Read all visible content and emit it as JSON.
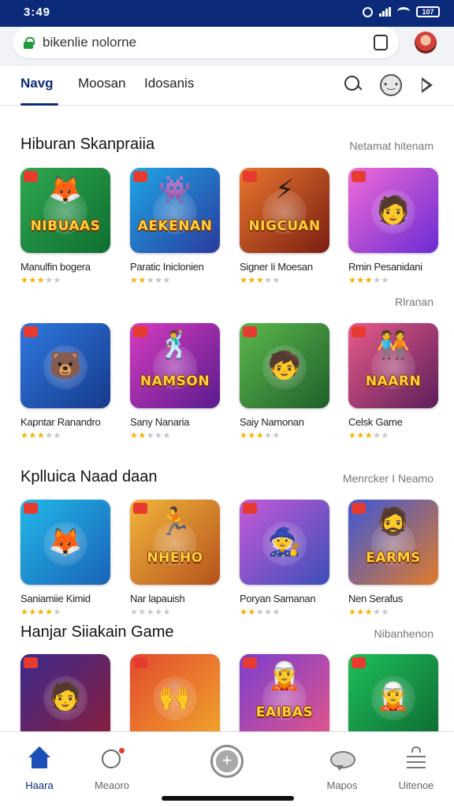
{
  "status": {
    "time": "3:49",
    "battery": "107"
  },
  "url": {
    "text": "bikenlie nolorne"
  },
  "nav": {
    "tabs": [
      "Navg",
      "Moosan",
      "Idosanis"
    ]
  },
  "sections": [
    {
      "title": "Hiburan Skanpraiia",
      "more": "Netamat hitenam",
      "games": [
        {
          "name": "Manulfin bogera",
          "stars": 3,
          "banner": "NIBUAAS",
          "colors": [
            "#2fa84f",
            "#0f6e31"
          ],
          "glyph": "🦊"
        },
        {
          "name": "Paratic Iniclonien",
          "stars": 2,
          "banner": "AEKENAN",
          "colors": [
            "#1ea7e6",
            "#2a3a9e"
          ],
          "glyph": "👾"
        },
        {
          "name": "Signer Ii Moesan",
          "stars": 3,
          "banner": "NIGCUAN",
          "colors": [
            "#e8762d",
            "#7a1e12"
          ],
          "glyph": "⚡"
        },
        {
          "name": "Rmin Pesanidani",
          "stars": 3,
          "banner": "",
          "colors": [
            "#f06bd6",
            "#6a2bd3"
          ],
          "glyph": "🧑"
        }
      ]
    },
    {
      "title": "",
      "more": "Rlranan",
      "games": [
        {
          "name": "Kapntar Ranandro",
          "stars": 3,
          "banner": "",
          "colors": [
            "#2f79e0",
            "#173a8c"
          ],
          "glyph": "🐻"
        },
        {
          "name": "Sany Nanaria",
          "stars": 2,
          "banner": "NAMSON",
          "colors": [
            "#d63cc0",
            "#5a1c8e"
          ],
          "glyph": "🕺"
        },
        {
          "name": "Saiy Namonan",
          "stars": 3,
          "banner": "",
          "colors": [
            "#5cb84d",
            "#1f5e2a"
          ],
          "glyph": "🧒"
        },
        {
          "name": "Celsk Game",
          "stars": 3,
          "banner": "NAARN",
          "colors": [
            "#e85b8a",
            "#5b1e5a"
          ],
          "glyph": "🧑‍🤝‍🧑"
        }
      ]
    },
    {
      "title": "Kplluica Naad daan",
      "more": "Menrcker I Neamo",
      "games": [
        {
          "name": "Saniamiie Kimid",
          "stars": 4,
          "banner": "",
          "colors": [
            "#22b8e8",
            "#1a63b8"
          ],
          "glyph": "🦊"
        },
        {
          "name": "Nar lapauish",
          "stars": 0,
          "banner": "NHEHO",
          "colors": [
            "#f2b53c",
            "#b5521c"
          ],
          "glyph": "🏃"
        },
        {
          "name": "Poryan Samanan",
          "stars": 2,
          "banner": "",
          "colors": [
            "#c75ad8",
            "#3c4fb9"
          ],
          "glyph": "🧙"
        },
        {
          "name": "Nen Serafus",
          "stars": 3,
          "banner": "EARMS",
          "colors": [
            "#3c58d8",
            "#e07a2a"
          ],
          "glyph": "🧔"
        }
      ]
    },
    {
      "title": "Hanjar Siiakain Game",
      "more": "Nibanhenon",
      "games": [
        {
          "name": "",
          "stars": 0,
          "banner": "",
          "colors": [
            "#3b2a8e",
            "#8a1e3b"
          ],
          "glyph": "🧑"
        },
        {
          "name": "",
          "stars": 0,
          "banner": "",
          "colors": [
            "#e24a2e",
            "#f0a42c"
          ],
          "glyph": "🙌"
        },
        {
          "name": "",
          "stars": 0,
          "banner": "EAIBAS",
          "colors": [
            "#7b3fd0",
            "#e2558a"
          ],
          "glyph": "🧝"
        },
        {
          "name": "",
          "stars": 0,
          "banner": "",
          "colors": [
            "#1ec05a",
            "#0f6a33"
          ],
          "glyph": "🧝"
        }
      ]
    }
  ],
  "bottom_nav": [
    {
      "label": "Haara",
      "icon": "home-icon",
      "active": true
    },
    {
      "label": "Meaoro",
      "icon": "search-icon",
      "active": false
    },
    {
      "label": "",
      "icon": "add-icon",
      "active": false
    },
    {
      "label": "Mapos",
      "icon": "chat-icon",
      "active": false
    },
    {
      "label": "Uitenoe",
      "icon": "menu-icon",
      "active": false
    }
  ],
  "accent": "#0b2a7a"
}
